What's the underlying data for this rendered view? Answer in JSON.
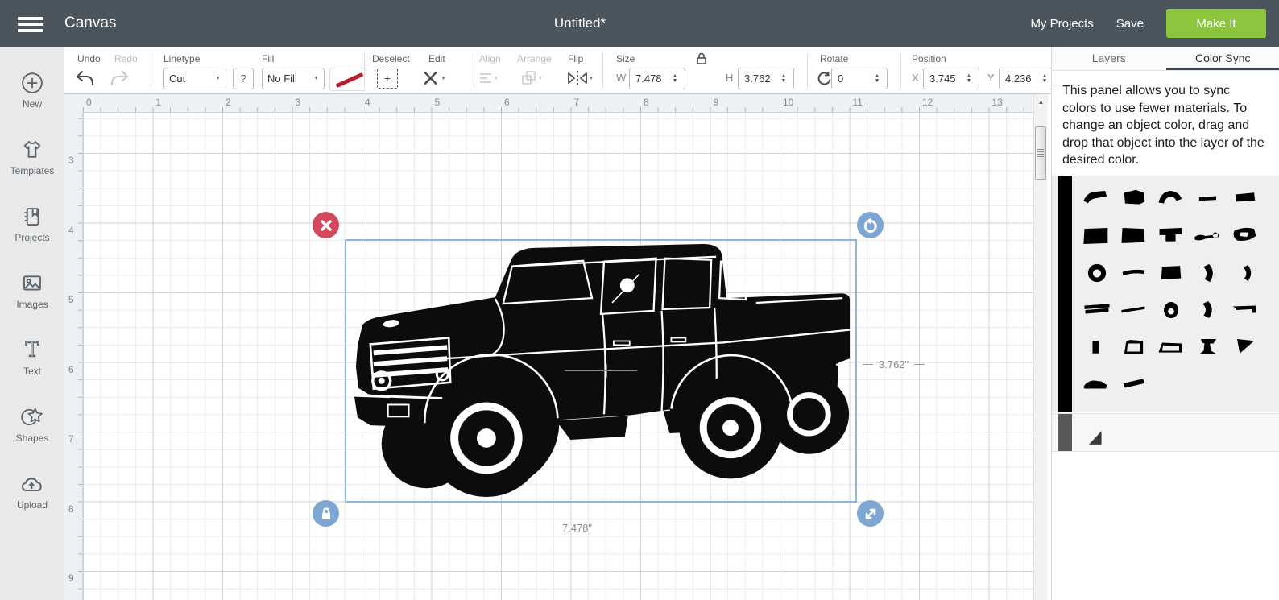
{
  "topbar": {
    "app_title": "Canvas",
    "doc_title": "Untitled*",
    "my_projects": "My Projects",
    "save": "Save",
    "make_it": "Make It",
    "colors": {
      "bar_bg": "#4b555d",
      "make_it_green": "#8cc63e"
    }
  },
  "sidebar": {
    "items": [
      {
        "label": "New",
        "icon": "plus-circle-icon"
      },
      {
        "label": "Templates",
        "icon": "tshirt-icon"
      },
      {
        "label": "Projects",
        "icon": "projects-book-icon"
      },
      {
        "label": "Images",
        "icon": "image-icon"
      },
      {
        "label": "Text",
        "icon": "text-icon"
      },
      {
        "label": "Shapes",
        "icon": "shapes-star-icon"
      },
      {
        "label": "Upload",
        "icon": "upload-cloud-icon"
      }
    ]
  },
  "toolbar": {
    "undo": "Undo",
    "redo": "Redo",
    "linetype": {
      "label": "Linetype",
      "value": "Cut",
      "help": "?"
    },
    "fill": {
      "label": "Fill",
      "value": "No Fill"
    },
    "deselect": "Deselect",
    "edit": "Edit",
    "align": "Align",
    "arrange": "Arrange",
    "flip": "Flip",
    "size": {
      "label": "Size",
      "w_label": "W",
      "w": "7.478",
      "h_label": "H",
      "h": "3.762",
      "locked": true
    },
    "rotate": {
      "label": "Rotate",
      "value": "0"
    },
    "position": {
      "label": "Position",
      "x_label": "X",
      "x": "3.745",
      "y_label": "Y",
      "y": "4.236"
    }
  },
  "canvas": {
    "h_ruler_numbers": [
      "0",
      "1",
      "2",
      "3",
      "4",
      "5",
      "6",
      "7",
      "8",
      "9",
      "10",
      "11",
      "12",
      "13"
    ],
    "v_ruler_numbers": [
      "3",
      "4",
      "5",
      "6",
      "7",
      "8",
      "9"
    ],
    "selection": {
      "object": "pickup-truck-silhouette",
      "width_label": "7.478\"",
      "height_label": "3.762\"",
      "border_color": "#8fb6de",
      "handle_red": "#d5485c",
      "handle_blue": "#7ea6d3"
    }
  },
  "right_panel": {
    "tabs": [
      {
        "label": "Layers",
        "active": false
      },
      {
        "label": "Color Sync",
        "active": true
      }
    ],
    "description_lines": [
      "This panel allows you to sync",
      "colors to use fewer materials. To",
      "change an object color, drag and",
      "drop that object into the layer of the",
      "desired color."
    ],
    "groups": [
      {
        "bar_color": "#000000",
        "bg": "#efeff0",
        "shapes": [
          "M3 15 Q7 6 15 5 L27 4 L29 10 L18 12 Q10 13 8 18 Z",
          "M7 6 L20 3 L29 6 L30 16 L24 19 L8 18 Z",
          "M4 17 Q7 5 17 4 Q27 5 30 13 L24 15 Q21 9 15 11 Q11 13 10 18 Z",
          "M8 11 L27 10 L27 14 L8 15 Z",
          "M7 8 L28 6 L29 15 L8 16 Z",
          "M4 5 L30 4 L30 21 L3 22 Z",
          "M5 4 L29 5 L30 20 L4 21 Z",
          "M5 5 L30 4 L30 11 L23 11 L23 19 L12 19 L12 12 L5 12 Z",
          "M3 14 Q9 10 15 13 L23 12 L28 10 Q31 11 30 14 L24 15 L15 16 Q8 19 3 17 Z M26 9 a3 3 0 1 1 0 6 a3 3 0 1 1 0 -6",
          "M6 7 Q17 2 28 5 L30 13 Q21 20 9 18 Q3 13 6 7 M13 9 L22 9 L20 14 L12 13 Z",
          "M18 3 a10 10 0 1 0 0.01 0 Z M18 9 a4.5 4.5 0 1 1 -0.01 0 Z",
          "M5 12 Q16 8 30 10 L29 14 Q16 12 6 16 Z",
          "M8 6 L28 5 L29 19 L7 20 Z",
          "M19 3 Q27 12 20 23 L14 20 Q19 13 13 6 Z",
          "M21 4 Q28 13 21 22 L17 19 Q22 13 16 7 Z",
          "M4 8 L32 6 L32 10 L4 12 Z M5 13 L31 11 L31 15 L5 17 Z",
          "M4 13 L30 9 L30 12 L4 16 Z",
          "M18 4 a8 9 0 1 0 0.01 0 Z M18 11 a3.5 3.5 0 1 1 -0.01 0 Z",
          "M18 3 Q26 12 19 22 L13 19 Q18 12 12 6 Z",
          "M4 9 L30 8 L30 16 L26 16 L26 12 L8 13 L8 11 Z",
          "M13 6 L20 6 L20 20 L13 20 Z",
          "M7 21 L9 8 Q10 5 14 5 L28 6 L28 21 Z M11 9 L25 9 L25 18 L10 18 Z",
          "M4 19 L8 8 L30 9 L30 19 Z M9 11 L27 12 L27 17 L8 17 Z",
          "M10 4 L27 4 L24 9 L20 9 L21 17 L28 21 L8 21 L13 17 L14 9 L11 8 Z",
          "M9 4 L28 6 L12 20 Z",
          "M3 16 Q7 9 15 9 L23 10 L29 14 L28 18 L4 18 Z",
          "M6 12 L28 7 L30 12 L8 17 Z"
        ]
      },
      {
        "bar_color": "#58595b",
        "bg": "#f7f7f8",
        "shapes": [
          "M9 21 L23 6 L23 21 Z"
        ]
      }
    ]
  }
}
